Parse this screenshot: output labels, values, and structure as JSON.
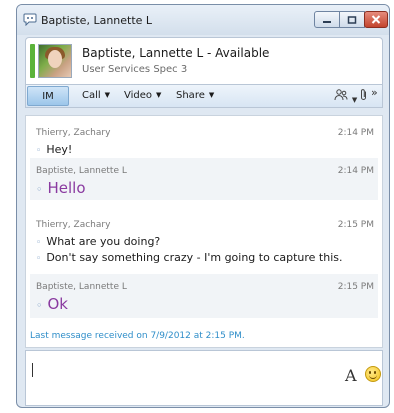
{
  "window": {
    "title": "Baptiste, Lannette L"
  },
  "contact": {
    "name_status": "Baptiste, Lannette L - Available",
    "job_title": "User Services Spec 3",
    "presence_color": "#5bb33a"
  },
  "toolbar": {
    "im_label": "IM",
    "call_label": "Call",
    "video_label": "Video",
    "share_label": "Share",
    "people_icon": "people-icon",
    "attach_icon": "paperclip-icon",
    "overflow_glyph": "»"
  },
  "messages": [
    {
      "sender": "Thierry, Zachary",
      "time": "2:14 PM",
      "lines": [
        "Hey!"
      ]
    },
    {
      "sender": "Baptiste, Lannette L",
      "time": "2:14 PM",
      "lines": [
        "Hello"
      ]
    },
    {
      "sender": "Thierry, Zachary",
      "time": "2:15 PM",
      "lines": [
        "What are you doing?",
        "Don't say something crazy - I'm going to capture this."
      ]
    },
    {
      "sender": "Baptiste, Lannette L",
      "time": "2:15 PM",
      "lines": [
        "Ok"
      ]
    }
  ],
  "status": {
    "last_message": "Last message received on 7/9/2012 at 2:15 PM."
  },
  "compose": {
    "font_label": "A",
    "emoticon_icon": "smiley-icon"
  }
}
